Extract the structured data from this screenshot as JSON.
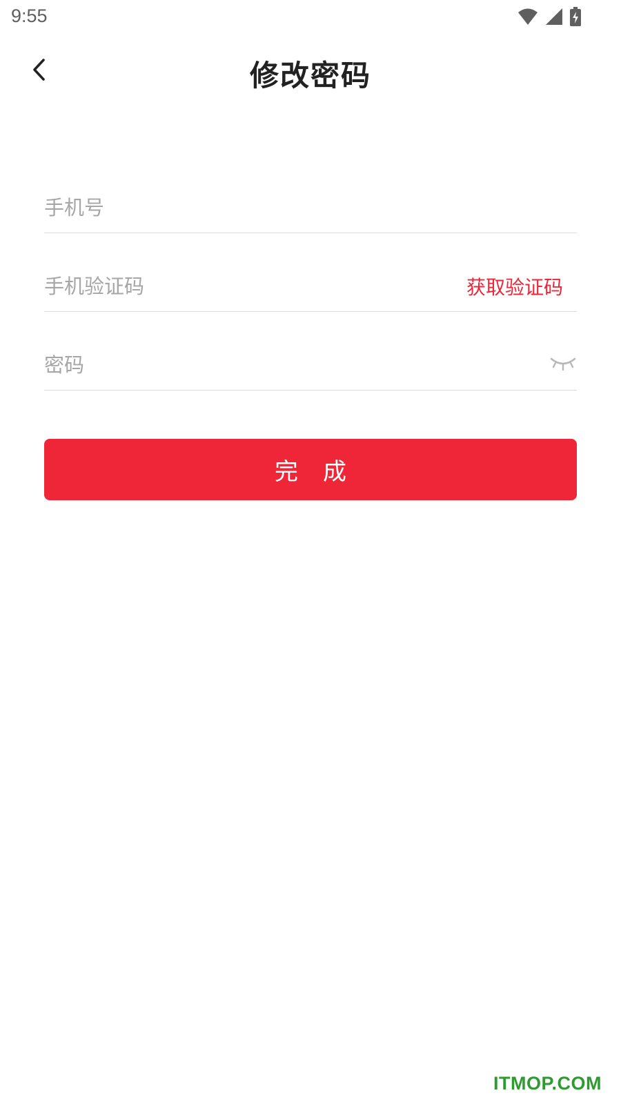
{
  "status_bar": {
    "time": "9:55",
    "icons": [
      "wifi-icon",
      "signal-icon",
      "battery-charging-icon"
    ]
  },
  "header": {
    "back_icon": "chevron-left-icon",
    "title": "修改密码"
  },
  "form": {
    "phone": {
      "value": "",
      "placeholder": "手机号"
    },
    "code": {
      "value": "",
      "placeholder": "手机验证码",
      "get_code_label": "获取验证码"
    },
    "password": {
      "value": "",
      "placeholder": "密码",
      "toggle_icon": "eye-closed-icon"
    }
  },
  "submit": {
    "label": "完成"
  },
  "watermark": "ITMOP.COM",
  "colors": {
    "accent": "#ef2638",
    "placeholder": "#a6a6a6",
    "divider": "#dcdcdc",
    "title": "#222222",
    "watermark": "#2d9b2f"
  }
}
